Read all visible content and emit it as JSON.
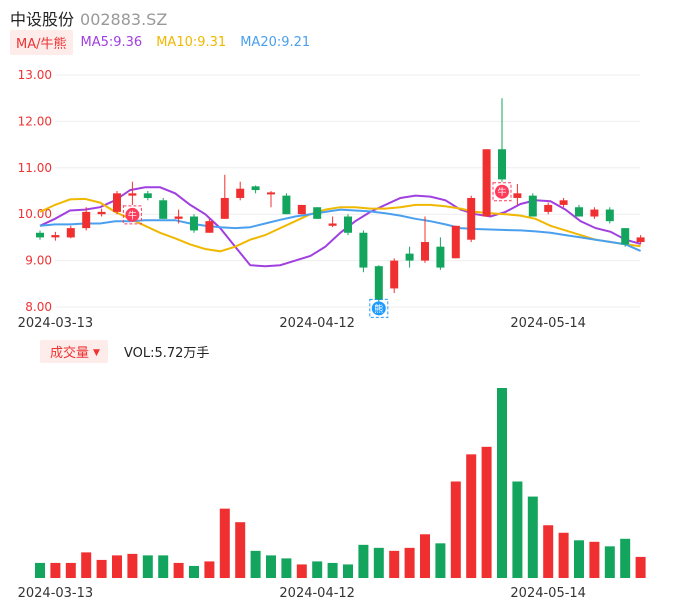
{
  "header": {
    "name": "中设股份",
    "code": "002883.SZ"
  },
  "legend": {
    "tag": "MA/牛熊",
    "ma5": "MA5:9.36",
    "ma10": "MA10:9.31",
    "ma20": "MA20:9.21",
    "ma5_color": "#a040e0",
    "ma10_color": "#f0b800",
    "ma20_color": "#4aa0ee"
  },
  "volume_legend": {
    "tag": "成交量",
    "caret": "▼",
    "value": "VOL:5.72万手"
  },
  "colors": {
    "up": "#f03030",
    "down": "#13a55e",
    "bull_badge": "#ff3b5c",
    "bear_badge": "#1e9bff"
  },
  "chart_data": [
    {
      "type": "candlestick",
      "yticks": [
        "13.00",
        "12.00",
        "11.00",
        "10.00",
        "9.00",
        "8.00"
      ],
      "ylim": [
        8.0,
        13.0
      ],
      "xticks": [
        {
          "index": 1,
          "label": "2024-03-13"
        },
        {
          "index": 18,
          "label": "2024-04-12"
        },
        {
          "index": 33,
          "label": "2024-05-14"
        }
      ],
      "candles": [
        {
          "o": 9.6,
          "c": 9.5,
          "h": 9.65,
          "l": 9.45
        },
        {
          "o": 9.5,
          "c": 9.55,
          "h": 9.62,
          "l": 9.43
        },
        {
          "o": 9.5,
          "c": 9.7,
          "h": 9.75,
          "l": 9.48
        },
        {
          "o": 9.7,
          "c": 10.05,
          "h": 10.15,
          "l": 9.65
        },
        {
          "o": 10.0,
          "c": 10.05,
          "h": 10.12,
          "l": 9.95
        },
        {
          "o": 10.05,
          "c": 10.45,
          "h": 10.5,
          "l": 10.0
        },
        {
          "o": 10.4,
          "c": 10.45,
          "h": 10.7,
          "l": 10.2
        },
        {
          "o": 10.45,
          "c": 10.35,
          "h": 10.5,
          "l": 10.3
        },
        {
          "o": 10.3,
          "c": 9.9,
          "h": 10.35,
          "l": 9.9
        },
        {
          "o": 9.9,
          "c": 9.95,
          "h": 10.1,
          "l": 9.8
        },
        {
          "o": 9.95,
          "c": 9.65,
          "h": 10.0,
          "l": 9.6
        },
        {
          "o": 9.6,
          "c": 9.85,
          "h": 9.9,
          "l": 9.6
        },
        {
          "o": 9.9,
          "c": 10.35,
          "h": 10.85,
          "l": 9.9
        },
        {
          "o": 10.35,
          "c": 10.55,
          "h": 10.7,
          "l": 10.3
        },
        {
          "o": 10.6,
          "c": 10.52,
          "h": 10.62,
          "l": 10.45
        },
        {
          "o": 10.45,
          "c": 10.47,
          "h": 10.5,
          "l": 10.15
        },
        {
          "o": 10.4,
          "c": 10.0,
          "h": 10.45,
          "l": 10.0
        },
        {
          "o": 10.0,
          "c": 10.2,
          "h": 10.2,
          "l": 10.0
        },
        {
          "o": 10.15,
          "c": 9.9,
          "h": 10.15,
          "l": 9.9
        },
        {
          "o": 9.75,
          "c": 9.8,
          "h": 9.95,
          "l": 9.72
        },
        {
          "o": 9.95,
          "c": 9.6,
          "h": 10.0,
          "l": 9.55
        },
        {
          "o": 9.6,
          "c": 8.85,
          "h": 9.65,
          "l": 8.75
        },
        {
          "o": 8.88,
          "c": 8.15,
          "h": 8.9,
          "l": 8.1
        },
        {
          "o": 8.4,
          "c": 9.0,
          "h": 9.05,
          "l": 8.3
        },
        {
          "o": 9.15,
          "c": 9.0,
          "h": 9.3,
          "l": 8.85
        },
        {
          "o": 9.0,
          "c": 9.4,
          "h": 9.95,
          "l": 8.95
        },
        {
          "o": 9.3,
          "c": 8.85,
          "h": 9.5,
          "l": 8.8
        },
        {
          "o": 9.05,
          "c": 9.75,
          "h": 9.75,
          "l": 9.05
        },
        {
          "o": 9.45,
          "c": 10.35,
          "h": 10.4,
          "l": 9.4
        },
        {
          "o": 9.95,
          "c": 11.4,
          "h": 11.4,
          "l": 9.95
        },
        {
          "o": 11.4,
          "c": 10.75,
          "h": 12.5,
          "l": 10.7
        },
        {
          "o": 10.35,
          "c": 10.45,
          "h": 10.65,
          "l": 10.2
        },
        {
          "o": 10.4,
          "c": 9.95,
          "h": 10.45,
          "l": 9.95
        },
        {
          "o": 10.05,
          "c": 10.2,
          "h": 10.25,
          "l": 10.0
        },
        {
          "o": 10.2,
          "c": 10.3,
          "h": 10.35,
          "l": 10.15
        },
        {
          "o": 10.15,
          "c": 9.95,
          "h": 10.2,
          "l": 9.95
        },
        {
          "o": 9.95,
          "c": 10.1,
          "h": 10.15,
          "l": 9.9
        },
        {
          "o": 10.1,
          "c": 9.85,
          "h": 10.15,
          "l": 9.8
        },
        {
          "o": 9.7,
          "c": 9.35,
          "h": 9.7,
          "l": 9.3
        },
        {
          "o": 9.4,
          "c": 9.5,
          "h": 9.55,
          "l": 9.35
        }
      ],
      "series": [
        {
          "key": "ma5",
          "values": [
            9.75,
            9.9,
            10.08,
            10.1,
            10.15,
            10.3,
            10.52,
            10.58,
            10.58,
            10.45,
            10.2,
            10.0,
            9.7,
            9.3,
            8.9,
            8.88,
            8.9,
            9.0,
            9.1,
            9.3,
            9.6,
            9.85,
            10.05,
            10.2,
            10.35,
            10.4,
            10.38,
            10.3,
            10.1,
            10.0,
            9.95,
            10.05,
            10.22,
            10.3,
            10.28,
            10.1,
            9.85,
            9.7,
            9.62,
            9.45,
            9.36
          ]
        },
        {
          "key": "ma10",
          "values": [
            10.05,
            10.2,
            10.32,
            10.33,
            10.25,
            10.05,
            9.9,
            9.75,
            9.6,
            9.48,
            9.35,
            9.25,
            9.2,
            9.3,
            9.45,
            9.55,
            9.7,
            9.85,
            10.0,
            10.1,
            10.15,
            10.15,
            10.12,
            10.12,
            10.15,
            10.2,
            10.2,
            10.17,
            10.12,
            10.05,
            10.02,
            10.0,
            9.97,
            9.9,
            9.75,
            9.65,
            9.55,
            9.45,
            9.4,
            9.35,
            9.31
          ]
        },
        {
          "key": "ma20",
          "values": [
            9.75,
            9.78,
            9.78,
            9.8,
            9.8,
            9.85,
            9.85,
            9.87,
            9.87,
            9.87,
            9.8,
            9.75,
            9.72,
            9.7,
            9.72,
            9.8,
            9.88,
            9.95,
            10.0,
            10.05,
            10.1,
            10.08,
            10.06,
            10.02,
            9.97,
            9.9,
            9.85,
            9.78,
            9.7,
            9.68,
            9.67,
            9.66,
            9.65,
            9.63,
            9.6,
            9.55,
            9.5,
            9.45,
            9.4,
            9.35,
            9.21
          ]
        }
      ],
      "markers": [
        {
          "index": 6,
          "label": "牛",
          "type": "bull"
        },
        {
          "index": 22,
          "label": "熊",
          "type": "bear",
          "dy": -4
        },
        {
          "index": 30,
          "label": "牛",
          "type": "bull"
        }
      ]
    },
    {
      "type": "bar",
      "title": "成交量",
      "values": [
        1.0,
        1.0,
        1.0,
        1.7,
        1.2,
        1.5,
        1.6,
        1.5,
        1.5,
        1.0,
        0.8,
        1.1,
        4.6,
        3.7,
        1.8,
        1.5,
        1.3,
        0.9,
        1.1,
        1.0,
        0.9,
        2.2,
        2.0,
        1.8,
        2.0,
        2.9,
        2.3,
        6.4,
        8.2,
        8.7,
        12.6,
        6.4,
        5.4,
        3.5,
        3.0,
        2.5,
        2.4,
        2.1,
        2.6,
        1.4
      ],
      "colors": [
        "down",
        "up",
        "up",
        "up",
        "up",
        "up",
        "up",
        "down",
        "down",
        "up",
        "down",
        "up",
        "up",
        "up",
        "down",
        "down",
        "down",
        "up",
        "down",
        "down",
        "down",
        "down",
        "down",
        "up",
        "up",
        "up",
        "down",
        "up",
        "up",
        "up",
        "down",
        "down",
        "down",
        "up",
        "up",
        "down",
        "up",
        "down",
        "down",
        "up"
      ],
      "xticks": [
        {
          "index": 1,
          "label": "2024-03-13"
        },
        {
          "index": 18,
          "label": "2024-04-12"
        },
        {
          "index": 33,
          "label": "2024-05-14"
        }
      ]
    }
  ]
}
